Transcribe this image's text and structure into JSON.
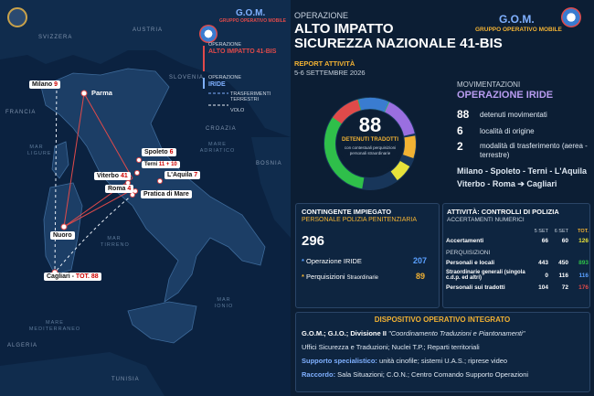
{
  "map": {
    "countries": [
      "SVIZZERA",
      "AUSTRIA",
      "SLOVENIA",
      "CROAZIA",
      "BOSNIA",
      "FRANCIA",
      "TUNISIA",
      "ALGERIA"
    ],
    "seas": [
      "MAR LIGURE",
      "MAR TIRRENO",
      "MARE ADRIATICO",
      "MAR IONIO",
      "MARE MEDITERRANEO"
    ],
    "cities": {
      "milano": "Milano",
      "milano_n": "9",
      "parma": "Parma",
      "spoleto": "Spoleto",
      "spoleto_n": "6",
      "terni": "Terni",
      "terni_n": "11 + 10",
      "viterbo": "Viterbo",
      "viterbo_n": "41",
      "laquila": "L'Aquila",
      "laquila_n": "7",
      "roma": "Roma",
      "roma_n": "4",
      "pratica": "Pratica di Mare",
      "nuoro": "Nuoro",
      "cagliari": "Cagliari",
      "cagliari_tot": "TOT. 88"
    },
    "logo": "G.O.M.",
    "logo_sub": "GRUPPO OPERATIVO MOBILE",
    "legend": {
      "op_label_1": "OPERAZIONE",
      "op_1": "ALTO IMPATTO 41-BIS",
      "op_label_2": "OPERAZIONE",
      "op_2": "IRIDE",
      "leg_1": "TRASFERIMENTI TERRESTRI",
      "leg_2": "VOLO"
    }
  },
  "header": {
    "small": "OPERAZIONE",
    "title_1": "ALTO IMPATTO",
    "title_2": "SICUREZZA NAZIONALE 41-BIS",
    "gom": "G.O.M.",
    "gom_sub": "GRUPPO OPERATIVO MOBILE",
    "report": "REPORT ATTIVITÀ",
    "date": "5-6 SETTEMBRE 2026"
  },
  "donut": {
    "value": "88",
    "label": "DETENUTI TRADOTTI",
    "sub": "con contestuali perquisizioni personali straordinarie"
  },
  "mov": {
    "heading": "MOVIMENTAZIONI",
    "title": "OPERAZIONE IRIDE",
    "s1": "88",
    "l1": "detenuti movimentati",
    "s2": "6",
    "l2": "località di origine",
    "s3": "2",
    "l3": "modalità di trasferimento (aerea - terrestre)",
    "route1": "Milano - Spoleto - Terni - L'Aquila",
    "route2": "Viterbo - Roma ➔ Cagliari"
  },
  "contingente": {
    "h": "CONTINGENTE IMPIEGATO",
    "sub": "PERSONALE POLIZIA PENITENZIARIA",
    "total": "296",
    "r1": "Operazione IRIDE",
    "v1": "207",
    "r2": "Perquisizioni",
    "r2s": "Straordinarie",
    "v2": "89"
  },
  "attivita": {
    "h": "ATTIVITÀ: CONTROLLI DI POLIZIA",
    "sub": "ACCERTAMENTI NUMERICI",
    "cols": [
      "5 SET",
      "6 SET",
      "TOT."
    ],
    "rows": [
      {
        "label": "Accertamenti",
        "v": [
          "66",
          "60",
          "126"
        ]
      },
      {
        "label": "PERQUISIZIONI",
        "v": [
          "",
          "",
          ""
        ]
      },
      {
        "label": "Personali e locali",
        "v": [
          "443",
          "450",
          "893"
        ]
      },
      {
        "label": "Straordinarie generali (singola c.d.p. ed altri)",
        "v": [
          "0",
          "116",
          "116"
        ]
      },
      {
        "label": "Personali sui tradotti",
        "v": [
          "104",
          "72",
          "176"
        ]
      }
    ]
  },
  "dispositivo": {
    "h": "DISPOSITIVO OPERATIVO INTEGRATO",
    "l1a": "G.O.M.; G.I.O.; Divisione II",
    "l1b": "\"Coordinamento Traduzioni e Piantonamenti\"",
    "l2": "Uffici Sicurezza e Traduzioni; Nuclei T.P.; Reparti territoriali",
    "l3h": "Supporto specialistico:",
    "l3": " unità cinofile; sistemi U.A.S.; riprese video",
    "l4h": "Raccordo:",
    "l4": " Sala Situazioni; C.O.N.; Centro Comando Supporto Operazioni"
  },
  "colors": {
    "accent": "#f2b233",
    "red": "#e04a4a",
    "blue": "#5aa0ff",
    "purple": "#b89cf0"
  }
}
